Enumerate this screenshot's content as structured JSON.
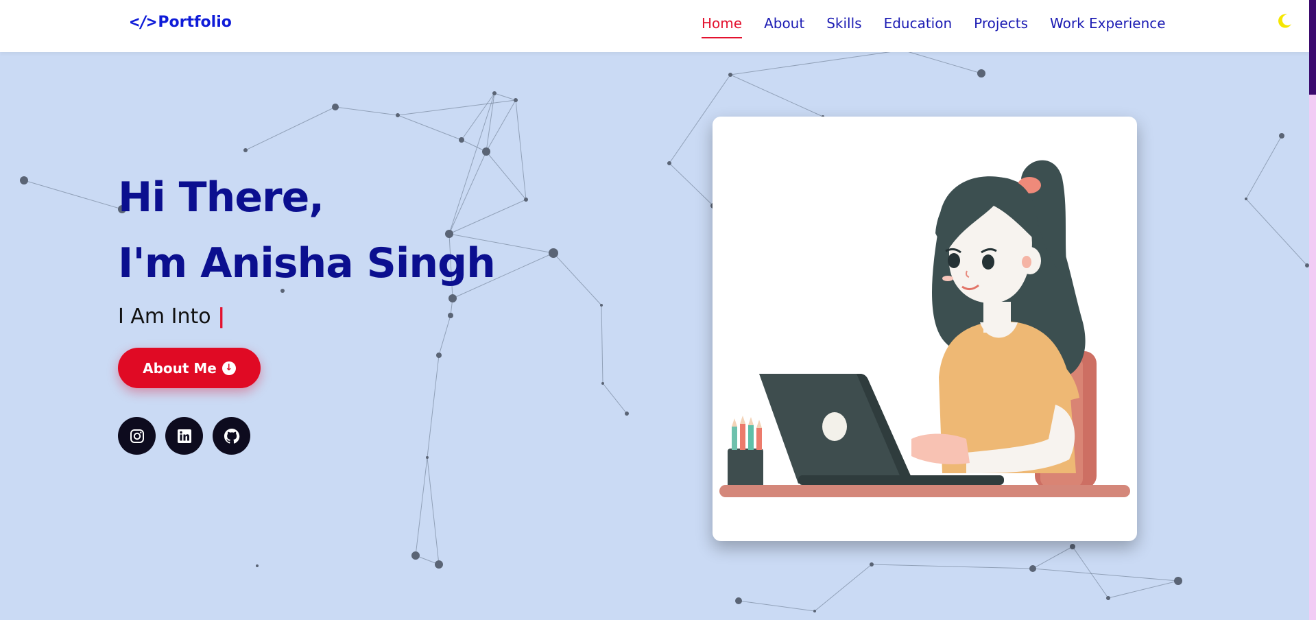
{
  "header": {
    "logo_text": "Portfolio",
    "logo_glyph": "</>",
    "nav": [
      {
        "label": "Home",
        "active": true
      },
      {
        "label": "About",
        "active": false
      },
      {
        "label": "Skills",
        "active": false
      },
      {
        "label": "Education",
        "active": false
      },
      {
        "label": "Projects",
        "active": false
      },
      {
        "label": "Work Experience",
        "active": false
      }
    ],
    "theme_icon": "moon-icon"
  },
  "hero": {
    "line1": "Hi There,",
    "line2": "I'm Anisha Singh",
    "typing_prefix": "I Am Into",
    "typing_cursor": "|",
    "button_label": "About Me",
    "button_icon": "arrow-down-circle-icon",
    "socials": [
      {
        "name": "instagram-icon"
      },
      {
        "name": "linkedin-icon"
      },
      {
        "name": "github-icon"
      }
    ],
    "illustration": "girl-at-laptop-illustration"
  },
  "colors": {
    "background": "#cadaf4",
    "accent_red": "#e00a24",
    "heading_blue": "#0b0f8f",
    "nav_blue": "#1b1bb3",
    "logo_blue": "#0e1bd8",
    "moon_yellow": "#f5e600"
  }
}
